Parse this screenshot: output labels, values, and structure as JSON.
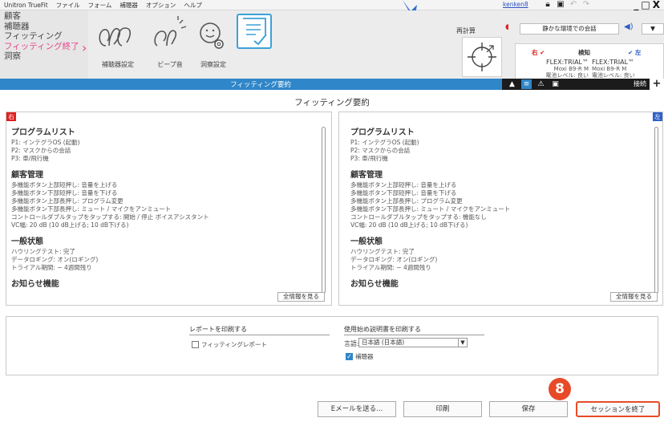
{
  "menubar": {
    "app": "Unitron TrueFit",
    "items": [
      "ファイル",
      "フォーム",
      "補聴器",
      "オプション",
      "ヘルプ"
    ],
    "user": "kenken8",
    "window_controls": "_□X"
  },
  "workflow": {
    "steps": [
      "顧客",
      "補聴器",
      "フィッティング",
      "フィッティング終了",
      "洞察"
    ],
    "tools": [
      "補聴器設定",
      "ビープ音",
      "洞察設定"
    ],
    "recalc": "再計算",
    "environment": "静かな環境での会話",
    "right_label": "右 ✔",
    "detect_label": "検知",
    "left_label": "✔ 左",
    "right_device": [
      "FLEX:TRIAL™",
      "Moxi B9-R M",
      "電池レベル: 良い"
    ],
    "left_device": [
      "FLEX:TRIAL™",
      "Moxi B9-R M",
      "電池レベル: 良い"
    ]
  },
  "bar": {
    "title": "フィッティング要約",
    "connect": "接続",
    "plus": "+"
  },
  "page_title": "フィッティング要約",
  "panels": {
    "right": {
      "badge": "右",
      "program_title": "プログラムリスト",
      "programs": [
        "P1: インテグラOS (起動)",
        "P2: マスクからの会話",
        "P3: 車/飛行機"
      ],
      "client_title": "顧客管理",
      "client_items": [
        "多機能ボタン上部短押し: 音量を上げる",
        "多機能ボタン下部短押し: 音量を下げる",
        "多機能ボタン上部長押し: プログラム変更",
        "多機能ボタン下部長押し: ミュート / マイクをアンミュート",
        "コントロールダブルタップをタップする: 開始 / 停止 ボイスアシスタント",
        "VC幅: 20 dB (10 dB上げる; 10 dB下げる)"
      ],
      "general_title": "一般状態",
      "general_items": [
        "ハウリングテスト: 完了",
        "データロギング: オン(ロギング)",
        "トライアル期間: ~ 4週間残り"
      ],
      "notify_title": "お知らせ機能",
      "show_all": "全情報を見る"
    },
    "left": {
      "badge": "左",
      "program_title": "プログラムリスト",
      "programs": [
        "P1: インテグラOS (起動)",
        "P2: マスクからの会話",
        "P3: 車/飛行機"
      ],
      "client_title": "顧客管理",
      "client_items": [
        "多機能ボタン上部短押し: 音量を上げる",
        "多機能ボタン下部短押し: 音量を下げる",
        "多機能ボタン上部長押し: プログラム変更",
        "多機能ボタン下部長押し: ミュート / マイクをアンミュート",
        "コントロールダブルタップをタップする: 機能なし",
        "VC幅: 20 dB (10 dB上げる; 10 dB下げる)"
      ],
      "general_title": "一般状態",
      "general_items": [
        "ハウリングテスト: 完了",
        "データロギング: オン(ロギング)",
        "トライアル期間: ~ 4週間残り"
      ],
      "notify_title": "お知らせ機能",
      "show_all": "全情報を見る"
    }
  },
  "print": {
    "report_title": "レポートを印刷する",
    "report_option": "フィッティングレポート",
    "manual_title": "使用始め説明書を印刷する",
    "language_label": "言語:",
    "language_value": "日本語 (日本語)",
    "device_option": "補聴器"
  },
  "buttons": {
    "email": "Eメールを送る...",
    "print": "印刷",
    "save": "保存",
    "end_session": "セッションを終了"
  },
  "step_badge": "8",
  "colors": {
    "accent_blue": "#2f86c8",
    "pink": "#e8468a",
    "right_red": "#e02020",
    "left_blue": "#2f5fc8",
    "highlight_orange": "#e84a28"
  }
}
